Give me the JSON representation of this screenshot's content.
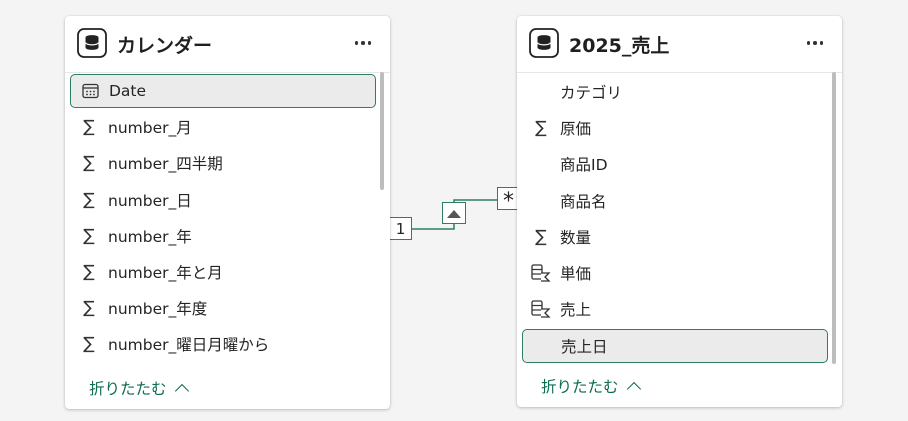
{
  "left_table": {
    "title": "カレンダー",
    "icon": "table-icon",
    "fields": [
      {
        "label": "Date",
        "icon": "calendar-icon",
        "selected": true
      },
      {
        "label": "number_月",
        "icon": "sigma-icon"
      },
      {
        "label": "number_四半期",
        "icon": "sigma-icon"
      },
      {
        "label": "number_日",
        "icon": "sigma-icon"
      },
      {
        "label": "number_年",
        "icon": "sigma-icon"
      },
      {
        "label": "number_年と月",
        "icon": "sigma-icon"
      },
      {
        "label": "number_年度",
        "icon": "sigma-icon"
      },
      {
        "label": "number_曜日月曜から",
        "icon": "sigma-icon"
      }
    ],
    "collapse_label": "折りたたむ"
  },
  "right_table": {
    "title": "2025_売上",
    "icon": "table-icon",
    "fields": [
      {
        "label": "カテゴリ",
        "icon": "none"
      },
      {
        "label": "原価",
        "icon": "sigma-icon"
      },
      {
        "label": "商品ID",
        "icon": "none"
      },
      {
        "label": "商品名",
        "icon": "none"
      },
      {
        "label": "数量",
        "icon": "sigma-icon"
      },
      {
        "label": "単価",
        "icon": "calculated-column-icon"
      },
      {
        "label": "売上",
        "icon": "calculated-column-icon"
      },
      {
        "label": "売上日",
        "icon": "none",
        "selected": true
      }
    ],
    "collapse_label": "折りたたむ"
  },
  "relationship": {
    "one_side_label": "1",
    "many_side_label": "*",
    "direction_icon": "single-direction-arrow-icon",
    "line_color": "#2e7d65"
  },
  "colors": {
    "accent": "#2e7d65",
    "link": "#0f6b52",
    "selected_bg": "#ebebeb"
  }
}
